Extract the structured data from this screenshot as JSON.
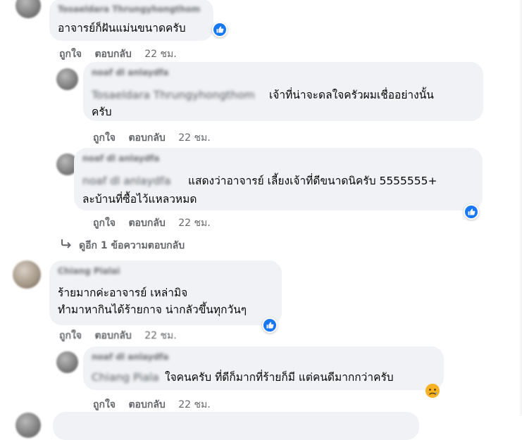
{
  "actions": {
    "like": "ถูกใจ",
    "reply": "ตอบกลับ",
    "time": "22 ชม."
  },
  "comments": [
    {
      "name": "Tosaeldara Thrungyhongthom",
      "lines": [
        "อาจารย์ก็ฝันแม่นขนาดครับ"
      ],
      "reaction": "like-icon"
    },
    {
      "name": "noaf dl anlaydfa",
      "mention": "Tosaeldara Thrungyhongthom",
      "lines": [
        "เจ้าที่น่าจะดลใจครัวผมเชื่ออย่างนั้น",
        "ครับ"
      ]
    },
    {
      "name": "noaf dl anlaydfa",
      "mention": "noaf dl anlaydfa",
      "lines": [
        "แสดงว่าอาจารย์ เลี้ยงเจ้าที่ดีขนาดนิครับ 5555555+",
        "ละบ้านที่ซื้อไว้แหลวหมด"
      ],
      "reaction": "like-icon"
    },
    {
      "name": "Chiang Pialai",
      "lines": [
        "ร้ายมากค่ะอาจารย์ เหล่ามิจ",
        "ทำมาหากินได้ร้ายกาจ น่ากลัวขึ้นทุกวันๆ"
      ],
      "reaction": "like-icon"
    },
    {
      "name": "noaf dl anlaydfa",
      "mention": "Chiang Pialai",
      "lines": [
        "ใจคนครับ ที่ดีก็มากที่ร้ายก็มี แต่คนดีมากกว่าครับ"
      ],
      "reaction": "sad-icon"
    }
  ],
  "view_more": "ดูอีก 1 ข้อความตอบกลับ",
  "colors": {
    "bubble": "#f0f2f5",
    "like_blue": "#1877f2",
    "meta_grey": "#65676b",
    "sad_yellow": "#f7b125"
  }
}
